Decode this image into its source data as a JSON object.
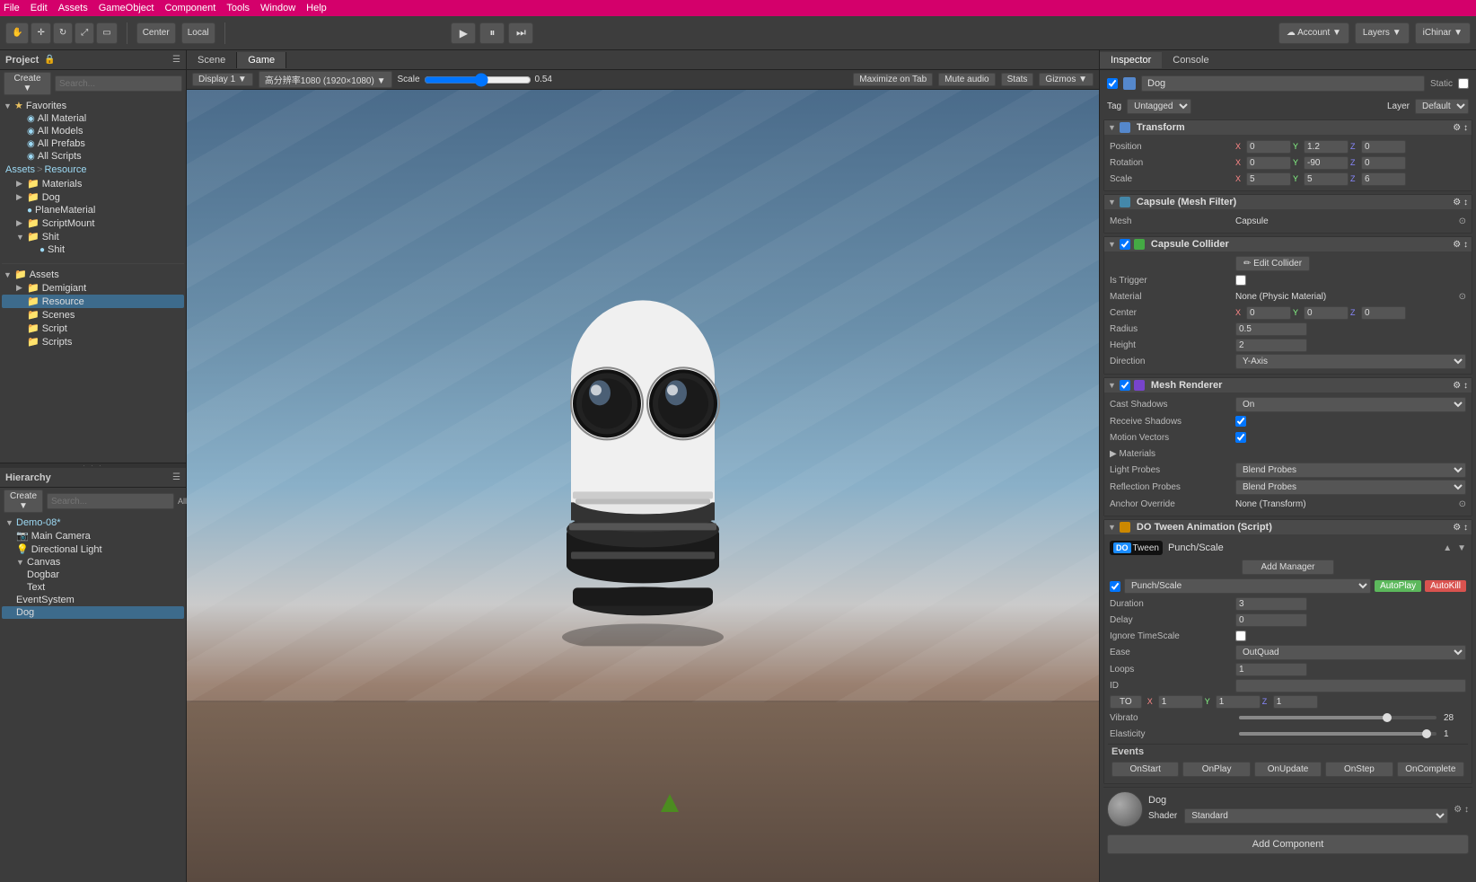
{
  "menubar": {
    "items": [
      "File",
      "Edit",
      "Assets",
      "GameObject",
      "Component",
      "Tools",
      "Window",
      "Help"
    ]
  },
  "toolbar": {
    "account_label": "Account",
    "layers_label": "Layers",
    "ichinbar_label": "iChinar",
    "play_btn": "▶",
    "pause_btn": "⏸",
    "step_btn": "⏭",
    "local_btn": "Local",
    "center_btn": "Center"
  },
  "project_panel": {
    "title": "Project",
    "favorites": {
      "label": "Favorites",
      "items": [
        "All Material",
        "All Models",
        "All Prefabs",
        "All Scripts"
      ]
    },
    "assets_header": "Assets  Resource",
    "assets_tree": [
      {
        "label": "Materials",
        "indent": 1,
        "type": "folder"
      },
      {
        "label": "Dog",
        "indent": 1,
        "type": "folder"
      },
      {
        "label": "PlaneMaterial",
        "indent": 1,
        "type": "file"
      },
      {
        "label": "ScriptMount",
        "indent": 1,
        "type": "folder"
      },
      {
        "label": "Shit",
        "indent": 1,
        "type": "folder"
      },
      {
        "label": "Shit",
        "indent": 2,
        "type": "file"
      }
    ],
    "bottom_tree": [
      {
        "label": "Assets",
        "indent": 0,
        "type": "folder",
        "expanded": true
      },
      {
        "label": "Demigiant",
        "indent": 1,
        "type": "folder"
      },
      {
        "label": "Resource",
        "indent": 1,
        "type": "folder",
        "selected": true
      },
      {
        "label": "Scenes",
        "indent": 1,
        "type": "folder"
      },
      {
        "label": "Script",
        "indent": 1,
        "type": "folder"
      },
      {
        "label": "Scripts",
        "indent": 1,
        "type": "folder"
      }
    ]
  },
  "hierarchy_panel": {
    "title": "Hierarchy",
    "scene": "Demo-08*",
    "items": [
      {
        "label": "Main Camera",
        "indent": 1,
        "type": "camera"
      },
      {
        "label": "Directional Light",
        "indent": 1,
        "type": "light"
      },
      {
        "label": "Canvas",
        "indent": 1,
        "type": "canvas",
        "expanded": true
      },
      {
        "label": "Dogbar",
        "indent": 2,
        "type": "obj"
      },
      {
        "label": "Text",
        "indent": 2,
        "type": "text"
      },
      {
        "label": "EventSystem",
        "indent": 1,
        "type": "obj"
      },
      {
        "label": "Dog",
        "indent": 1,
        "type": "obj",
        "selected": true
      }
    ]
  },
  "scene_tabs": {
    "tabs": [
      "Scene",
      "Game"
    ],
    "active": "Game"
  },
  "scene_toolbar": {
    "display": "Display 1",
    "resolution": "高分辨率1080 (1920×1080)",
    "scale_label": "Scale",
    "scale_value": "0.54",
    "maximize": "Maximize on Tab",
    "mute": "Mute audio",
    "stats": "Stats",
    "gizmos": "Gizmos"
  },
  "inspector": {
    "tabs": [
      "Inspector",
      "Console"
    ],
    "active": "Inspector",
    "game_object": "Dog",
    "static": "Static",
    "tag": "Untagged",
    "layer": "Default",
    "transform": {
      "label": "Transform",
      "position": {
        "x": "0",
        "y": "1.2",
        "z": "0"
      },
      "rotation": {
        "x": "0",
        "y": "-90",
        "z": "0"
      },
      "scale": {
        "x": "5",
        "y": "5",
        "z": "6"
      }
    },
    "mesh_filter": {
      "label": "Capsule (Mesh Filter)",
      "mesh": "Capsule"
    },
    "capsule_collider": {
      "label": "Capsule Collider",
      "is_trigger": false,
      "material": "None (Physic Material)",
      "center": {
        "x": "0",
        "y": "0",
        "z": "0"
      },
      "radius": "0.5",
      "height": "2",
      "direction": "Y-Axis"
    },
    "mesh_renderer": {
      "label": "Mesh Renderer",
      "cast_shadows": "On",
      "receive_shadows": true,
      "motion_vectors": true,
      "materials": "Materials",
      "light_probes": "Blend Probes",
      "reflection_probes": "Blend Probes",
      "anchor_override": "None (Transform)"
    },
    "dotween": {
      "label": "DO Tween Animation (Script)",
      "punch_scale": "Punch/Scale",
      "autoplay": "AutoPlay",
      "autokill": "AutoKill",
      "duration": "3",
      "delay": "0",
      "ignore_timescale": false,
      "ease": "OutQuad",
      "loops": "1",
      "id": "",
      "to_label": "TO",
      "to_x": "1",
      "to_y": "1",
      "to_z": "1",
      "vibrato": "28",
      "vibrato_pct": 75,
      "elasticity": "1",
      "elasticity_pct": 95
    },
    "events": {
      "label": "Events",
      "buttons": [
        "OnStart",
        "OnPlay",
        "OnUpdate",
        "OnStep",
        "OnComplete"
      ]
    },
    "material": {
      "label": "Dog",
      "shader_label": "Shader",
      "shader": "Standard"
    },
    "add_component": "Add Component"
  }
}
